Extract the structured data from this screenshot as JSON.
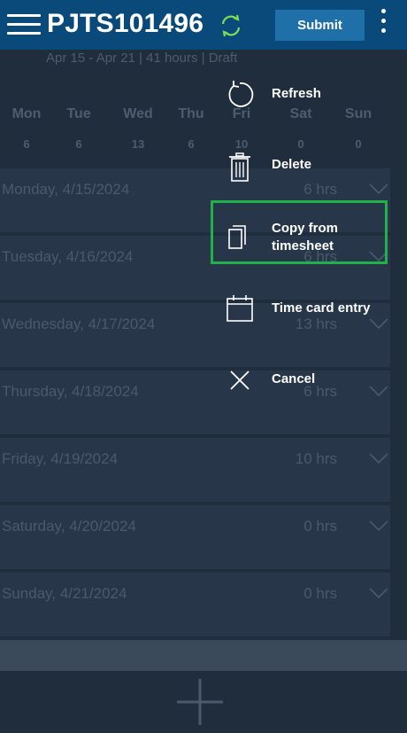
{
  "header": {
    "title": "PJTS101496",
    "submit_label": "Submit"
  },
  "subheader": "Apr 15 - Apr 21 | 41 hours | Draft",
  "week": [
    {
      "day": "Mon",
      "hours": "6"
    },
    {
      "day": "Tue",
      "hours": "6"
    },
    {
      "day": "Wed",
      "hours": "13"
    },
    {
      "day": "Thu",
      "hours": "6"
    },
    {
      "day": "Fri",
      "hours": "10"
    },
    {
      "day": "Sat",
      "hours": "0"
    },
    {
      "day": "Sun",
      "hours": "0"
    }
  ],
  "days": [
    {
      "label": "Monday, 4/15/2024",
      "total": "6 hrs"
    },
    {
      "label": "Tuesday, 4/16/2024",
      "total": "6 hrs"
    },
    {
      "label": "Wednesday, 4/17/2024",
      "total": "13 hrs"
    },
    {
      "label": "Thursday, 4/18/2024",
      "total": "6 hrs"
    },
    {
      "label": "Friday, 4/19/2024",
      "total": "10 hrs"
    },
    {
      "label": "Saturday, 4/20/2024",
      "total": "0 hrs"
    },
    {
      "label": "Sunday, 4/21/2024",
      "total": "0 hrs"
    }
  ],
  "menu": {
    "items": [
      {
        "label": "Refresh",
        "icon": "refresh-icon"
      },
      {
        "label": "Delete",
        "icon": "trash-icon"
      },
      {
        "label_line1": "Copy from",
        "label_line2": "timesheet",
        "icon": "copy-icon"
      },
      {
        "label": "Time card entry",
        "icon": "calendar-icon"
      },
      {
        "label": "Cancel",
        "icon": "close-icon"
      }
    ],
    "highlight_color": "#22b04a"
  },
  "colors": {
    "header_bg": "#0a4a7a",
    "submit_bg": "#1f6fa8",
    "sync_icon": "#7ed957"
  }
}
